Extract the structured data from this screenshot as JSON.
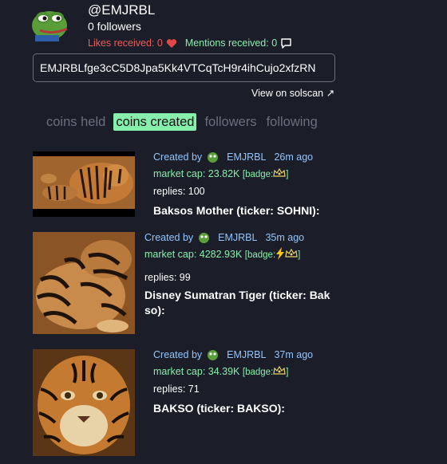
{
  "profile": {
    "username": "@EMJRBL",
    "followers": "0 followers",
    "likes_label": "Likes received: 0",
    "mentions_label": "Mentions received: 0",
    "address": "EMJRBLfge3cC5D8Jpa5Kk4VTCqTcH9r4ihCujo2xfzRN",
    "solscan_label": "View on solscan ↗"
  },
  "tabs": [
    {
      "label": "coins held",
      "active": false
    },
    {
      "label": "coins created",
      "active": true
    },
    {
      "label": "followers",
      "active": false
    },
    {
      "label": "following",
      "active": false
    }
  ],
  "coins": [
    {
      "created_by": "Created by",
      "creator": "EMJRBL",
      "age": "26m ago",
      "market_cap": "market cap: 23.82K",
      "badge_prefix": "[badge:",
      "badge_suffix": "]",
      "badge_icons": [
        "crown-icon"
      ],
      "replies": "replies: 100",
      "name": "Baksos Mother (ticker: SOHNI):"
    },
    {
      "created_by": "Created by",
      "creator": "EMJRBL",
      "age": "35m ago",
      "market_cap": "market cap: 4282.93K",
      "badge_prefix": "[badge:",
      "badge_suffix": "]",
      "badge_icons": [
        "lightning-icon",
        "crown-icon"
      ],
      "replies": "replies: 99",
      "name_line1": "Disney Sumatran Tiger (ticker: Bak",
      "name_line2": "so):"
    },
    {
      "created_by": "Created by",
      "creator": "EMJRBL",
      "age": "37m ago",
      "market_cap": "market cap: 34.39K",
      "badge_prefix": "[badge:",
      "badge_suffix": "]",
      "badge_icons": [
        "crown-icon"
      ],
      "replies": "replies: 71",
      "name": "BAKSO (ticker: BAKSO):"
    }
  ],
  "colors": {
    "background": "#1b1d28",
    "accent_green": "#86efac",
    "link_blue": "#93c5fd",
    "likes_red": "#f05b5b",
    "muted_tab": "#6b6f7d"
  }
}
